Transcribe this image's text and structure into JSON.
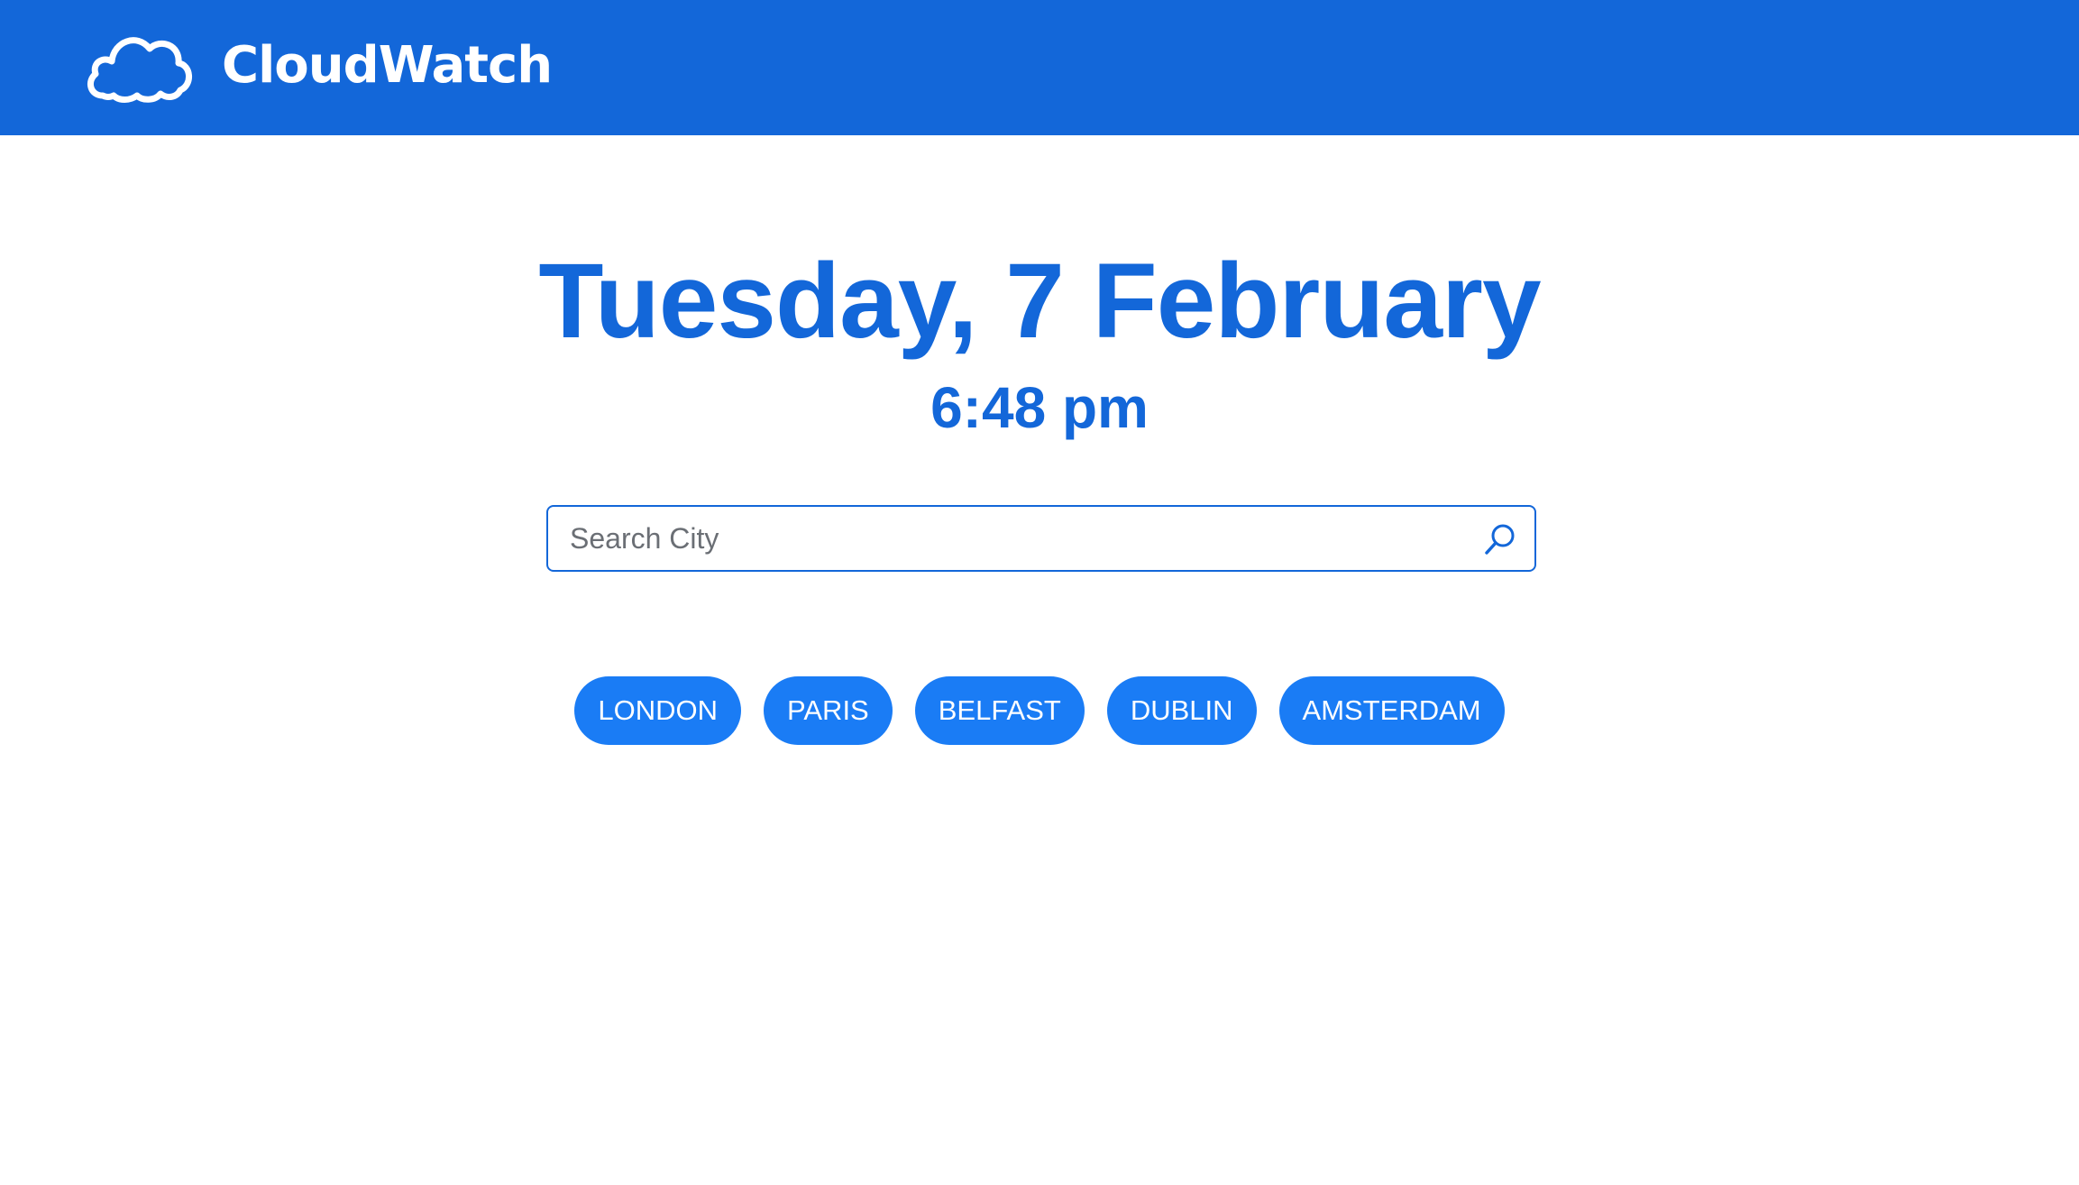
{
  "header": {
    "logo_icon": "cloud-icon",
    "app_name": "CloudWatch",
    "background_color": "#1367d9"
  },
  "main": {
    "date": "Tuesday, 7 February",
    "time": "6:48 pm",
    "accent_color": "#1367d9"
  },
  "search": {
    "placeholder": "Search City",
    "value": "",
    "icon": "search-icon"
  },
  "quick_cities": {
    "button_color": "#1a7cf5",
    "items": [
      {
        "label": "LONDON"
      },
      {
        "label": "PARIS"
      },
      {
        "label": "BELFAST"
      },
      {
        "label": "DUBLIN"
      },
      {
        "label": "AMSTERDAM"
      }
    ]
  }
}
